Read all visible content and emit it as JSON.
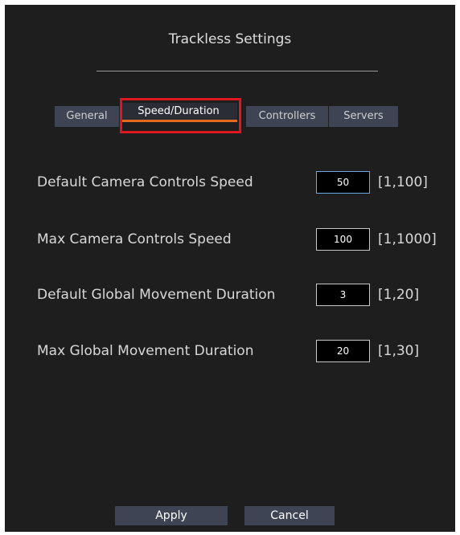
{
  "dialog": {
    "title": "Trackless Settings"
  },
  "tabs": [
    {
      "label": "General",
      "active": false
    },
    {
      "label": "Speed/Duration",
      "active": true
    },
    {
      "label": "Controllers",
      "active": false
    },
    {
      "label": "Servers",
      "active": false
    }
  ],
  "settings": [
    {
      "label": "Default Camera Controls Speed",
      "value": "50",
      "range": "[1,100]"
    },
    {
      "label": "Max Camera Controls Speed",
      "value": "100",
      "range": "[1,1000]"
    },
    {
      "label": "Default Global Movement Duration",
      "value": "3",
      "range": "[1,20]"
    },
    {
      "label": "Max Global Movement Duration",
      "value": "20",
      "range": "[1,30]"
    }
  ],
  "buttons": {
    "apply_label": "Apply",
    "cancel_label": "Cancel"
  },
  "colors": {
    "panel_bg": "#1e1e1e",
    "tab_bg": "#3e4453",
    "active_tab_underline": "#e06a1e",
    "highlight_box": "#e0161e",
    "focused_input_border": "#6fa6e8"
  }
}
